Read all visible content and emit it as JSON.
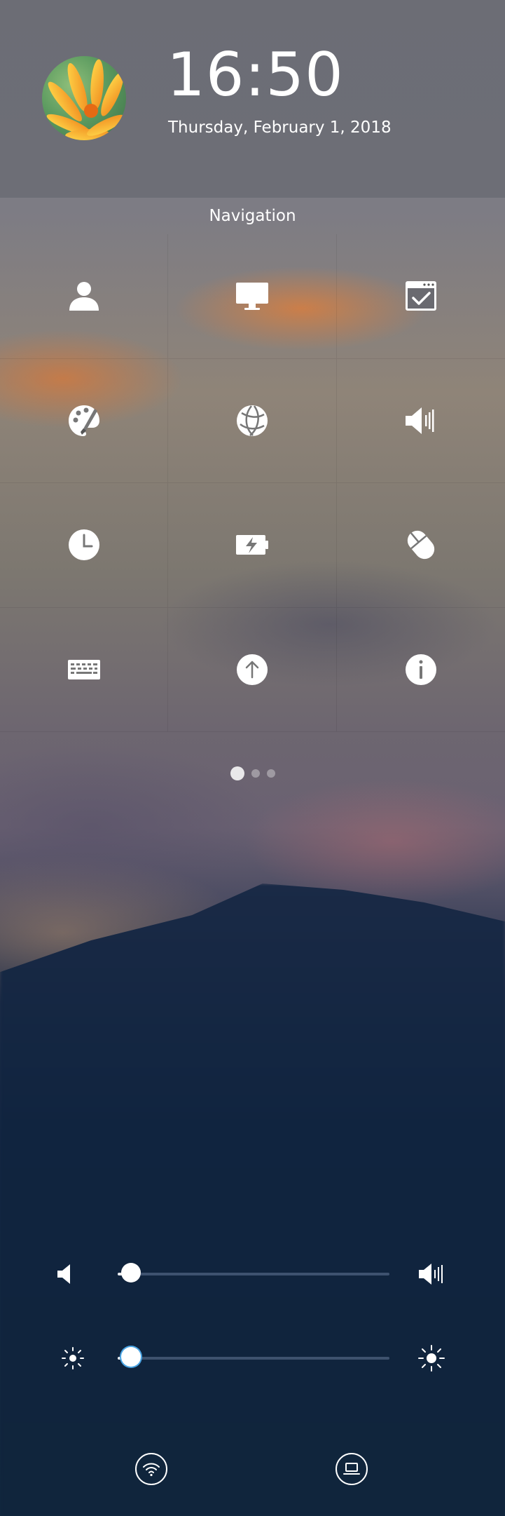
{
  "header": {
    "avatar_icon": "user-avatar-flower",
    "time": "16:50",
    "date": "Thursday, February 1, 2018"
  },
  "navigation": {
    "title": "Navigation",
    "items": [
      {
        "icon": "account-icon"
      },
      {
        "icon": "display-icon"
      },
      {
        "icon": "default-apps-icon"
      },
      {
        "icon": "personalization-icon"
      },
      {
        "icon": "network-icon"
      },
      {
        "icon": "sound-icon"
      },
      {
        "icon": "time-date-icon"
      },
      {
        "icon": "power-icon"
      },
      {
        "icon": "mouse-icon"
      },
      {
        "icon": "keyboard-icon"
      },
      {
        "icon": "update-icon"
      },
      {
        "icon": "system-info-icon"
      }
    ],
    "pages": 3,
    "current_page": 1
  },
  "controls": {
    "volume": {
      "level": 0.05,
      "low_icon": "speaker-low-icon",
      "high_icon": "speaker-high-icon"
    },
    "brightness": {
      "level": 0.05,
      "low_icon": "brightness-low-icon",
      "high_icon": "brightness-high-icon"
    }
  },
  "bottom": {
    "wifi_icon": "wifi-icon",
    "display_mode_icon": "laptop-icon"
  },
  "colors": {
    "accent": "#49a4e4",
    "foreground": "#ffffff"
  }
}
